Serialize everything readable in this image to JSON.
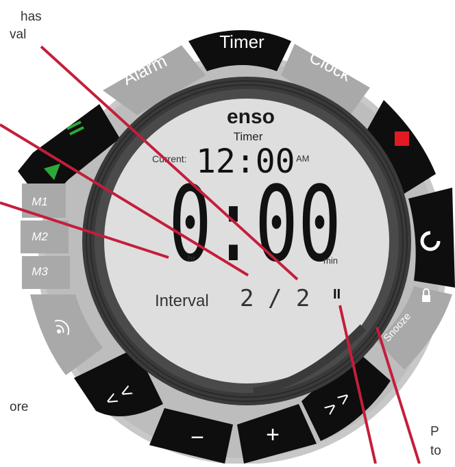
{
  "device": {
    "brand": "enso",
    "mode_title": "Timer",
    "current_label": "Current:",
    "current_time": "12:00",
    "am_pm": "AM",
    "main_time": "0:00",
    "hr_label": "hr",
    "min_label": "min",
    "interval_label": "Interval",
    "interval_value": "2 / 2",
    "pause_glyph": "II"
  },
  "tabs": {
    "alarm": "Alarm",
    "timer": "Timer",
    "clock": "Clock"
  },
  "memory": [
    "M1",
    "M2",
    "M3"
  ],
  "snooze_label": "Snooze",
  "nav": {
    "rewind": "< <",
    "minus": "−",
    "plus": "+",
    "forward": "> >"
  },
  "callouts": {
    "top_left_line1": "has",
    "top_left_line2": "val",
    "bottom_left": "ore",
    "bottom_right_line1": "P",
    "bottom_right_line2": "to"
  },
  "colors": {
    "ring": "#c4c4c4",
    "button": "#0e0e0e",
    "gray_button": "#a8a8a8",
    "lcd": "#dcdcdc",
    "callout_line": "#c41e3a",
    "stop": "#e21b23",
    "play": "#2fa83a"
  }
}
